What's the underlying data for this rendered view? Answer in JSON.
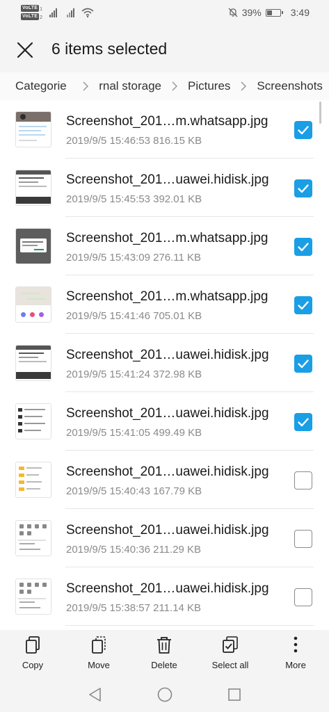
{
  "status_bar": {
    "volte": [
      "VoLTE",
      "VoLTE"
    ],
    "volte_sub": [
      "1",
      "2"
    ],
    "battery_percent": "39%",
    "battery_level": 0.39,
    "time": "3:49",
    "icons": [
      "signal-icon",
      "signal-icon",
      "wifi-icon",
      "mute-icon",
      "battery-icon"
    ]
  },
  "title_bar": {
    "title": "6 items selected",
    "close_icon": "close-icon"
  },
  "breadcrumb": [
    "Categories",
    "rnal storage",
    "Pictures",
    "Screenshots"
  ],
  "files": [
    {
      "name": "Screenshot_201…m.whatsapp.jpg",
      "meta": "2019/9/5 15:46:53 816.15 KB",
      "checked": true,
      "thumb": "whatsapp-chat"
    },
    {
      "name": "Screenshot_201…uawei.hidisk.jpg",
      "meta": "2019/9/5 15:45:53 392.01 KB",
      "checked": true,
      "thumb": "hidisk-dark"
    },
    {
      "name": "Screenshot_201…m.whatsapp.jpg",
      "meta": "2019/9/5 15:43:09 276.11 KB",
      "checked": true,
      "thumb": "whatsapp-dialog"
    },
    {
      "name": "Screenshot_201…m.whatsapp.jpg",
      "meta": "2019/9/5 15:41:46 705.01 KB",
      "checked": true,
      "thumb": "whatsapp-attach"
    },
    {
      "name": "Screenshot_201…uawei.hidisk.jpg",
      "meta": "2019/9/5 15:41:24 372.98 KB",
      "checked": true,
      "thumb": "hidisk-dark"
    },
    {
      "name": "Screenshot_201…uawei.hidisk.jpg",
      "meta": "2019/9/5 15:41:05 499.49 KB",
      "checked": true,
      "thumb": "hidisk-list"
    },
    {
      "name": "Screenshot_201…uawei.hidisk.jpg",
      "meta": "2019/9/5 15:40:43 167.79 KB",
      "checked": false,
      "thumb": "hidisk-folders"
    },
    {
      "name": "Screenshot_201…uawei.hidisk.jpg",
      "meta": "2019/9/5 15:40:36 211.29 KB",
      "checked": false,
      "thumb": "hidisk-grid"
    },
    {
      "name": "Screenshot_201…uawei.hidisk.jpg",
      "meta": "2019/9/5 15:38:57 211.14 KB",
      "checked": false,
      "thumb": "hidisk-grid"
    }
  ],
  "actions": [
    {
      "label": "Copy",
      "icon": "copy-icon"
    },
    {
      "label": "Move",
      "icon": "move-icon"
    },
    {
      "label": "Delete",
      "icon": "trash-icon"
    },
    {
      "label": "Select all",
      "icon": "select-all-icon"
    },
    {
      "label": "More",
      "icon": "more-vertical-icon"
    }
  ],
  "nav": [
    "back-icon",
    "home-icon",
    "recents-icon"
  ],
  "colors": {
    "accent": "#1a9ee6",
    "background": "#f4f4f4",
    "text": "#1a1a1a",
    "secondary_text": "#8a8a8a"
  }
}
